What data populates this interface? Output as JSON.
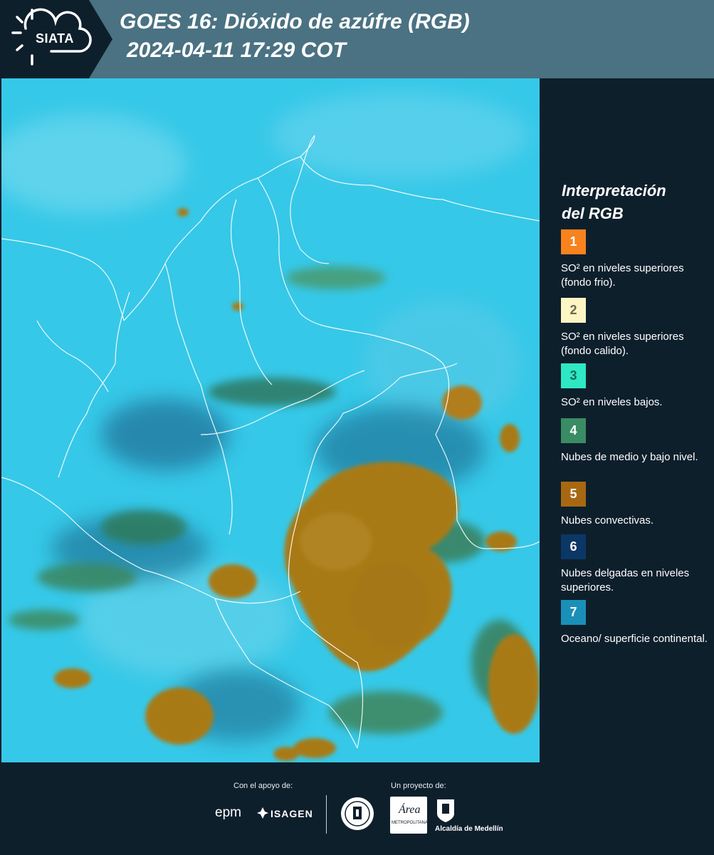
{
  "header": {
    "brand": "SIATA",
    "title": "GOES 16: Dióxido de azúfre (RGB)",
    "datetime": "2024-04-11 17:29 COT"
  },
  "legend": {
    "title_line1": "Interpretación",
    "title_line2": "del RGB",
    "items": [
      {
        "number": "1",
        "color": "#f7821e",
        "text": "SO² en niveles superiores (fondo frio)."
      },
      {
        "number": "2",
        "color": "#fdf5c3",
        "text": "SO² en niveles superiores (fondo calido)."
      },
      {
        "number": "3",
        "color": "#2ee8c4",
        "text": "SO² en niveles bajos."
      },
      {
        "number": "4",
        "color": "#3a8c64",
        "text": "Nubes de medio y bajo nivel."
      },
      {
        "number": "5",
        "color": "#a86812",
        "text": "Nubes convectivas."
      },
      {
        "number": "6",
        "color": "#0b3766",
        "text": "Nubes delgadas en niveles superiores."
      },
      {
        "number": "7",
        "color": "#1a8fb8",
        "text": "Oceano/ superficie continental."
      }
    ]
  },
  "footer": {
    "support_caption": "Con el apoyo de:",
    "project_caption": "Un proyecto de:",
    "epm": "epm",
    "isagen": "ISAGEN",
    "area_word": "Área",
    "area_sub": "METROPOLITANA",
    "alcaldia": "Alcaldía de Medellín"
  },
  "colors": {
    "background": "#0e1f2c",
    "header": "#4a7282",
    "map_base": "#36c8e8",
    "convective": "#a87a14",
    "midlevel": "#2f7a5a"
  }
}
